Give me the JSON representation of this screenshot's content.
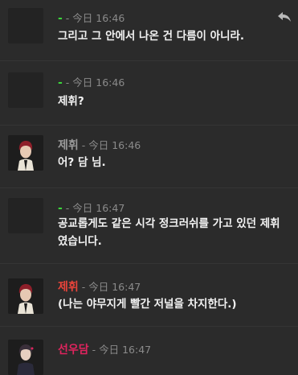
{
  "messages": [
    {
      "author": "-",
      "author_color": "#3bd63b",
      "timestamp": "- 今日 16:46",
      "body": "그리고 그 안에서 나온 건 다름이 아니라."
    },
    {
      "author": "-",
      "author_color": "#3bd63b",
      "timestamp": "- 今日 16:46",
      "body": "제휘?"
    },
    {
      "author": "제휘",
      "author_color": "#9a9a9a",
      "timestamp": "- 今日 16:46",
      "body": "어? 담 님."
    },
    {
      "author": "-",
      "author_color": "#3bd63b",
      "timestamp": "- 今日 16:47",
      "body": "공교롭게도 같은 시각 정크러쉬를 가고 있던 제휘였습니다."
    },
    {
      "author": "제휘",
      "author_color": "#e8443a",
      "timestamp": "- 今日 16:47",
      "body": "(나는 야무지게 빨간 저널을 차지한다.)"
    },
    {
      "author": "선우담",
      "author_color": "#e0245e",
      "timestamp": "- 今日 16:47",
      "body": ""
    }
  ],
  "icons": {
    "reply": "reply-arrow-icon"
  }
}
